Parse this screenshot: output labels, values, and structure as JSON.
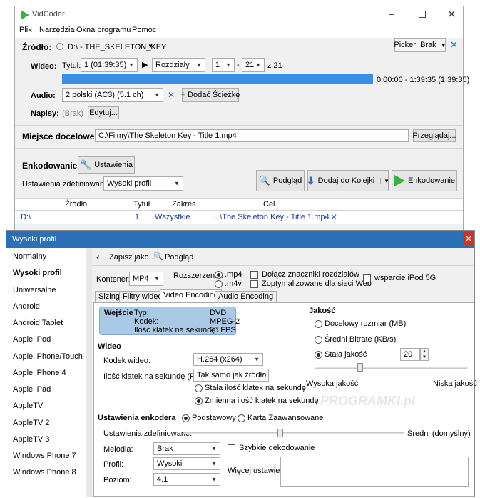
{
  "main_window": {
    "title": "VidCoder",
    "menu": [
      "Plik",
      "Narzędzia",
      "Okna programu",
      "Pomoc"
    ],
    "source": {
      "label": "Źródło:",
      "drive": "D:\\ - THE_SKELETON_KEY",
      "picker_label": "Picker: Brak"
    },
    "video": {
      "label": "Wideo:",
      "title_label": "Tytuł:",
      "title_value": "1 (01:39:35)",
      "range_type": "Rozdziały",
      "chapter_start": "1",
      "chapter_end": "21",
      "chapter_of": "z 21",
      "progress": 1.0,
      "time_range": "0:00:00 - 1:39:35  (1:39:35)"
    },
    "audio": {
      "label": "Audio:",
      "track": "2 polski (AC3) (5.1 ch)",
      "add_track_label": "Dodać Ścieżkę"
    },
    "subtitles": {
      "label": "Napisy:",
      "value": "(Brak)",
      "edit_label": "Edytuj..."
    },
    "destination": {
      "label": "Miejsce docelowe:",
      "path": "C:\\Filmy\\The Skeleton Key - Title 1.mp4",
      "browse_label": "Przeglądaj..."
    },
    "encoding": {
      "label": "Enkodowanie:",
      "settings_label": "Ustawienia",
      "preset_label": "Ustawienia zdefiniowane:",
      "preset_value": "Wysoki profil",
      "preview_label": "Podgląd",
      "queue_label": "Dodaj do Kolejki",
      "encode_label": "Enkodowanie"
    },
    "queue_table": {
      "headers": [
        "Źródło",
        "Tytuł",
        "Zakres",
        "Cel"
      ],
      "rows": [
        [
          "D:\\",
          "1",
          "Wszystkie",
          "...\\The Skeleton Key - Title 1.mp4"
        ]
      ]
    }
  },
  "preset_window": {
    "title": "Wysoki profil",
    "presets": [
      "Normalny",
      "Wysoki profil",
      "Uniwersalne",
      "Android",
      "Android Tablet",
      "Apple iPod",
      "Apple iPhone/Touch",
      "Apple iPhone 4",
      "Apple iPad",
      "AppleTV",
      "AppleTV 2",
      "AppleTV 3",
      "Windows Phone 7",
      "Windows Phone 8"
    ],
    "selected_preset": "Wysoki profil",
    "toolbar": {
      "save_label": "Zapisz jako...",
      "preview_label": "Podgląd"
    },
    "container": {
      "label": "Kontener:",
      "value": "MP4",
      "extension_label": "Rozszerzenie:",
      "ext_mp4": ".mp4",
      "ext_m4v": ".m4v",
      "chapter_markers": "Dołącz znaczniki rozdziałów",
      "web_optimized": "Zoptymalizowane dla sieci Web",
      "ipod5g": "wsparcie iPod 5G"
    },
    "tabs": [
      "Sizing",
      "Filtry wideo",
      "Video Encoding",
      "Audio Encoding"
    ],
    "active_tab": "Video Encoding",
    "input_info": {
      "heading": "Wejście",
      "type_label": "Typ:",
      "type_value": "DVD",
      "codec_label": "Kodek:",
      "codec_value": "MPEG-2",
      "fps_label": "Ilość klatek na sekundę:",
      "fps_value": "25 FPS"
    },
    "video": {
      "heading": "Wideo",
      "codec_label": "Kodek wideo:",
      "codec_value": "H.264 (x264)",
      "fps_label": "Ilość klatek na sekundę (FPS):",
      "fps_value": "Tak samo jak źródło",
      "constant_fps": "Stała ilość klatek na sekundę",
      "variable_fps": "Zmienna ilość klatek na sekundę"
    },
    "quality": {
      "heading": "Jakość",
      "target_size": "Docelowy rozmiar (MB)",
      "avg_bitrate": "Średni Bitrate (KB/s)",
      "constant_quality": "Stała jakość",
      "constant_value": "20",
      "slider_position": 0.3,
      "high_label": "Wysoka jakość",
      "low_label": "Niska jakość"
    },
    "encoder": {
      "heading": "Ustawienia enkodera",
      "basic": "Podstawowy",
      "advanced": "Karta Zaawansowane",
      "preset_label": "Ustawienia zdefiniowane:",
      "preset_slider_position": 0.44,
      "preset_value": "Średni (domyślny)",
      "tune_label": "Melodia:",
      "tune_value": "Brak",
      "fast_decode": "Szybkie dekodowanie",
      "profile_label": "Profil:",
      "profile_value": "Wysoki",
      "more_settings_label": "Więcej ustawień:",
      "level_label": "Poziom:",
      "level_value": "4.1"
    }
  },
  "watermark": "PROGRAMKI.pl",
  "colors": {
    "accent_blue": "#3a8ee6",
    "title_blue": "#2b6fb6",
    "info_box": "#a9c9e6",
    "green": "#3cb043"
  }
}
